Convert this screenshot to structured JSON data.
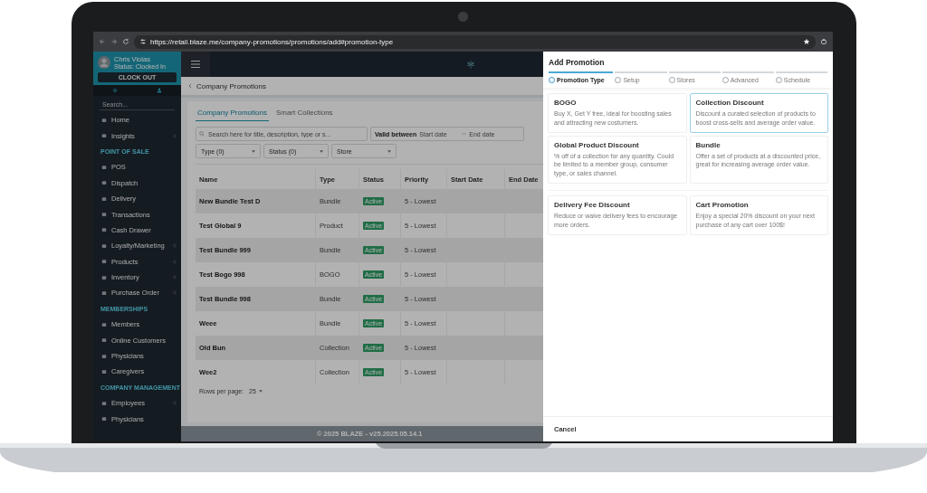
{
  "browser": {
    "url": "https://retail.blaze.me/company-promotions/promotions/add#promotion-type"
  },
  "sidebar": {
    "user": {
      "name": "Chris Violas",
      "status": "Status: Clocked In"
    },
    "clock_button": "CLOCK OUT",
    "search": {
      "placeholder": "Search..."
    },
    "sections": [
      {
        "items": [
          {
            "label": "Home",
            "expandable": false
          },
          {
            "label": "Insights",
            "expandable": true
          }
        ]
      },
      {
        "heading": "POINT OF SALE",
        "items": [
          {
            "label": "POS",
            "expandable": false
          },
          {
            "label": "Dispatch",
            "expandable": false
          },
          {
            "label": "Delivery",
            "expandable": false
          },
          {
            "label": "Transactions",
            "expandable": false
          },
          {
            "label": "Cash Drawer",
            "expandable": false
          },
          {
            "label": "Loyalty/Marketing",
            "expandable": true
          },
          {
            "label": "Products",
            "expandable": true
          },
          {
            "label": "Inventory",
            "expandable": true
          },
          {
            "label": "Purchase Order",
            "expandable": true
          }
        ]
      },
      {
        "heading": "MEMBERSHIPS",
        "items": [
          {
            "label": "Members",
            "expandable": false
          },
          {
            "label": "Online Customers",
            "expandable": false
          },
          {
            "label": "Physicians",
            "expandable": false
          },
          {
            "label": "Caregivers",
            "expandable": false
          }
        ]
      },
      {
        "heading": "COMPANY MANAGEMENT",
        "items": [
          {
            "label": "Employees",
            "expandable": true
          },
          {
            "label": "Physicians",
            "expandable": false
          }
        ]
      }
    ]
  },
  "page": {
    "title": "Company Promotions",
    "tabs": [
      {
        "label": "Company Promotions",
        "selected": true
      },
      {
        "label": "Smart Collections",
        "selected": false
      }
    ],
    "filters": {
      "search_placeholder": "Search here for title, description, type or s...",
      "range_label": "Valid between",
      "start_placeholder": "Start date",
      "end_placeholder": "End date",
      "selects": [
        "Type (0)",
        "Status (0)",
        "Store"
      ]
    },
    "table": {
      "columns": [
        "Name",
        "Type",
        "Status",
        "Priority",
        "Start Date",
        "End Date"
      ],
      "rows": [
        {
          "name": "New Bundle Test D",
          "type": "Bundle",
          "status": "Active",
          "priority": "5 - Lowest"
        },
        {
          "name": "Test Global 9",
          "type": "Product",
          "status": "Active",
          "priority": "5 - Lowest"
        },
        {
          "name": "Test Bundle 999",
          "type": "Bundle",
          "status": "Active",
          "priority": "5 - Lowest"
        },
        {
          "name": "Test Bogo 998",
          "type": "BOGO",
          "status": "Active",
          "priority": "5 - Lowest"
        },
        {
          "name": "Test Bundle 998",
          "type": "Bundle",
          "status": "Active",
          "priority": "5 - Lowest"
        },
        {
          "name": "Weee",
          "type": "Bundle",
          "status": "Active",
          "priority": "5 - Lowest"
        },
        {
          "name": "Old Bun",
          "type": "Collection",
          "status": "Active",
          "priority": "5 - Lowest"
        },
        {
          "name": "Wee2",
          "type": "Collection",
          "status": "Active",
          "priority": "5 - Lowest"
        }
      ]
    },
    "rows_per_page": {
      "label": "Rows per page:",
      "value": "25"
    },
    "footer": "© 2025 BLAZE - v25.2025.05.14.1"
  },
  "panel": {
    "title": "Add Promotion",
    "steps": [
      {
        "label": "Promotion Type",
        "selected": true
      },
      {
        "label": "Setup",
        "selected": false
      },
      {
        "label": "Stores",
        "selected": false
      },
      {
        "label": "Advanced",
        "selected": false
      },
      {
        "label": "Schedule",
        "selected": false
      }
    ],
    "groups": [
      {
        "cards": [
          {
            "title": "BOGO",
            "description": "Buy X, Get Y free, ideal for boosting sales and attracting new costumers.",
            "selected": false
          },
          {
            "title": "Collection Discount",
            "description": "Discount a curated selection of products to boost cross-sells and average order value.",
            "selected": true
          },
          {
            "title": "Global Product Discount",
            "description": "% off of a collection for any quantity. Could be limited to a member group, consumer type, or sales channel.",
            "selected": false
          },
          {
            "title": "Bundle",
            "description": "Offer a set of products at a discounted price, great for increasing average order value.",
            "selected": false
          }
        ]
      },
      {
        "cards": [
          {
            "title": "Delivery Fee Discount",
            "description": "Reduce or waive delivery fees to encourage more orders.",
            "selected": false
          },
          {
            "title": "Cart Promotion",
            "description": "Enjoy a special 20% discount on your next purchase of any cart over 100$!",
            "selected": false
          }
        ]
      }
    ],
    "cancel": "Cancel"
  }
}
